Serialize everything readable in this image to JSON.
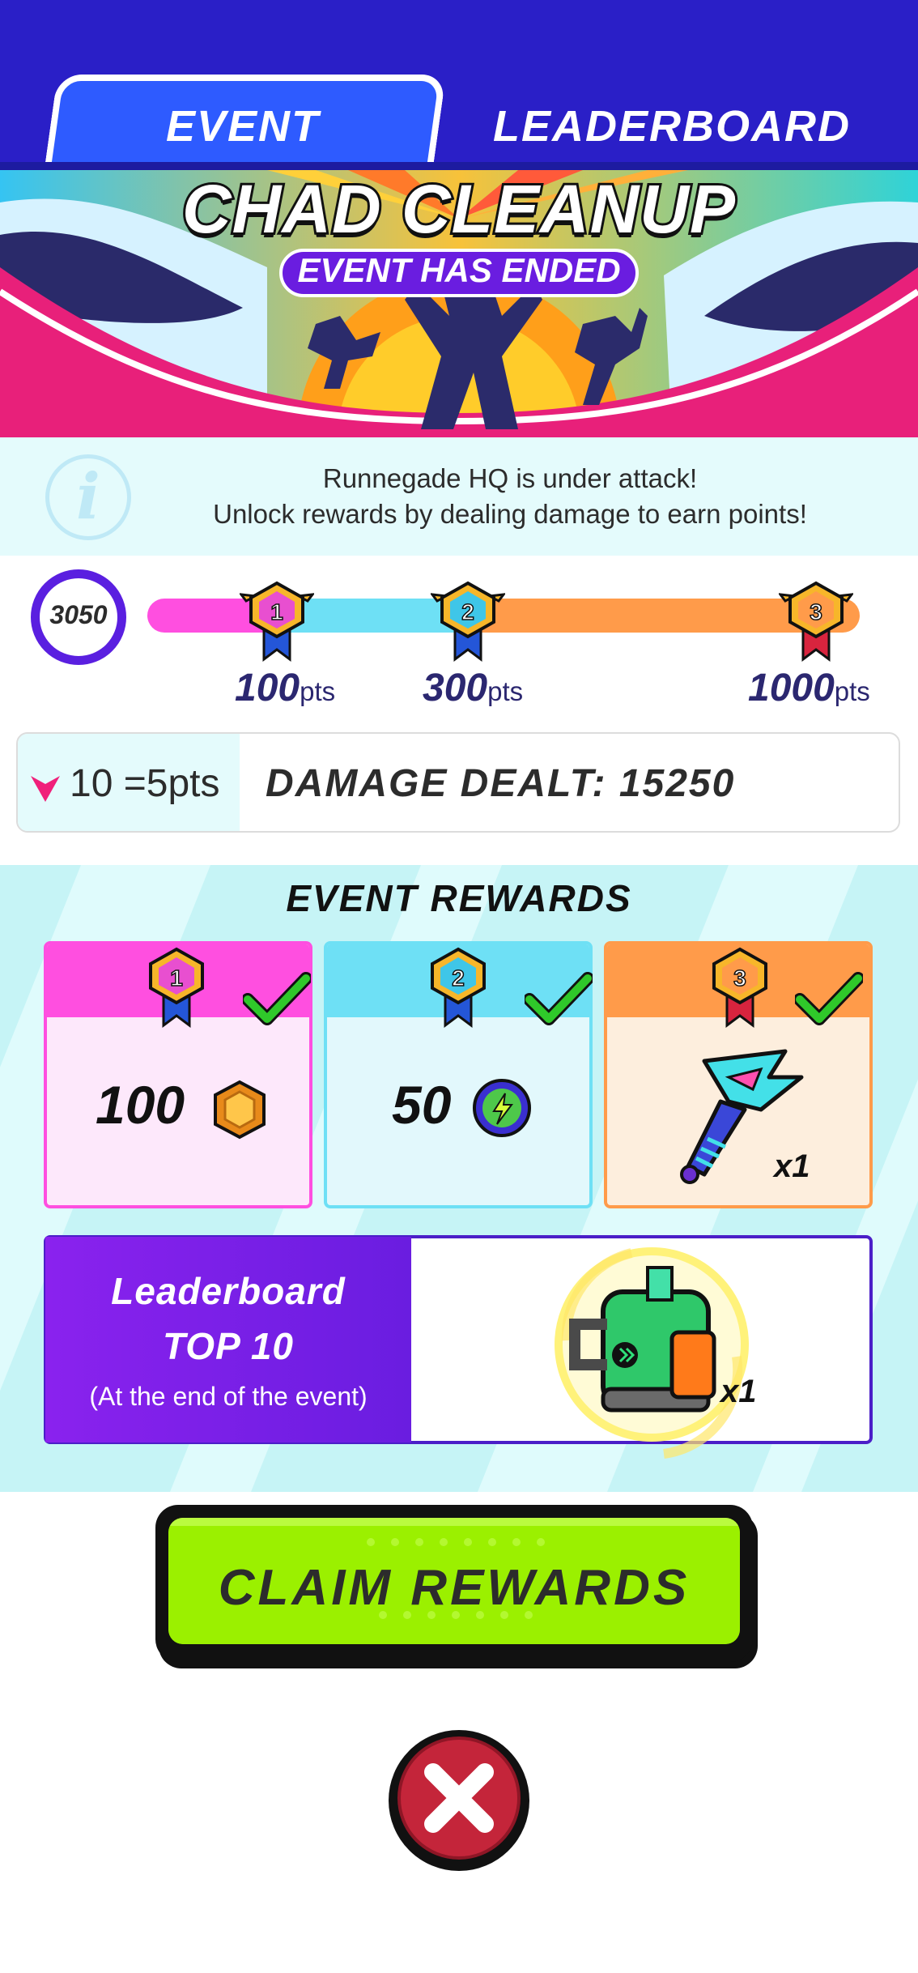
{
  "tabs": [
    {
      "label": "EVENT",
      "active": true
    },
    {
      "label": "LEADERBOARD",
      "active": false
    }
  ],
  "banner": {
    "title": "CHAD CLEANUP",
    "status": "EVENT HAS ENDED"
  },
  "info": {
    "icon": "info-icon",
    "line1": "Runnegade HQ is under attack!",
    "line2": "Unlock rewards by dealing damage to earn points!"
  },
  "progress": {
    "current_points": "3050",
    "milestones": [
      {
        "rank": "1",
        "points": "100",
        "unit": "pts",
        "color": "#ff4fe0"
      },
      {
        "rank": "2",
        "points": "300",
        "unit": "pts",
        "color": "#6ee0f5"
      },
      {
        "rank": "3",
        "points": "1000",
        "unit": "pts",
        "color": "#ff9b4a"
      }
    ]
  },
  "damage": {
    "rate": "10 =5pts",
    "dealt_label": "DAMAGE DEALT: 15250"
  },
  "rewards": {
    "title": "EVENT REWARDS",
    "tiers": [
      {
        "rank": "1",
        "amount": "100",
        "item": "coin-icon",
        "claimed": true
      },
      {
        "rank": "2",
        "amount": "50",
        "item": "energy-orb-icon",
        "claimed": true
      },
      {
        "rank": "3",
        "quantity": "x1",
        "item": "blaster-weapon-icon",
        "claimed": true
      }
    ],
    "leaderboard": {
      "line1": "Leaderboard",
      "line2": "TOP 10",
      "line3": "(At the end of the event)",
      "quantity": "x1",
      "item": "backpack-gear-icon"
    }
  },
  "actions": {
    "claim_label": "CLAIM REWARDS",
    "close_icon": "close-icon"
  },
  "colors": {
    "top_bar": "#2a1fc7",
    "active_tab": "#2e5bff",
    "accent_purple": "#5a1fe0",
    "claim_green": "#9bf000",
    "close_red": "#c4253a"
  }
}
